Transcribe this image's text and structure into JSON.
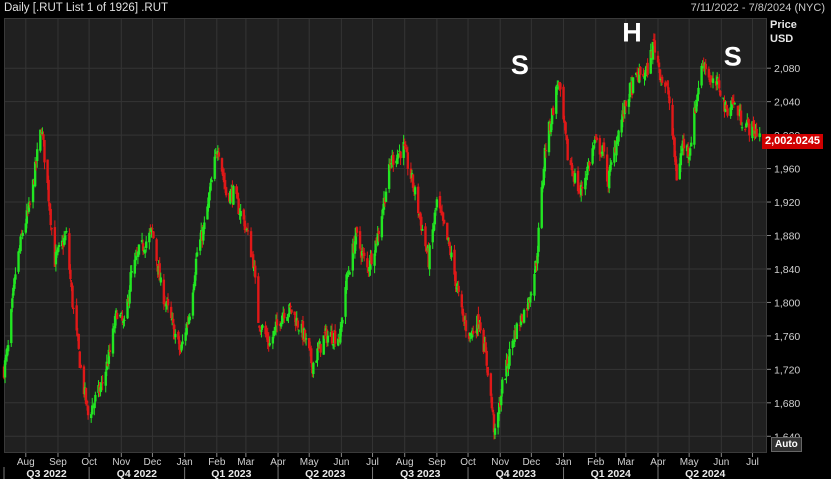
{
  "header": {
    "title": "Daily [.RUT List 1 of 1926] .RUT",
    "date_range": "7/11/2022 - 7/8/2024 (NYC)"
  },
  "axis": {
    "price_label": "Price",
    "currency": "USD",
    "auto_label": "Auto",
    "last_value": "2,002.0245"
  },
  "annotations": [
    {
      "text": "S",
      "date": "2023-11-20",
      "price": 2073
    },
    {
      "text": "H",
      "date": "2024-03-07",
      "price": 2112
    },
    {
      "text": "S",
      "date": "2024-06-12",
      "price": 2083
    }
  ],
  "colors": {
    "up": "#22e622",
    "down": "#e01818",
    "background": "#202020",
    "grid": "#343434",
    "last_price_bg": "#d00000"
  },
  "chart_data": {
    "type": "candlestick",
    "title": "Daily [.RUT List 1 of 1926] .RUT",
    "ylabel": "Price USD",
    "ylim": [
      1620,
      2140
    ],
    "xlim": [
      "2022-07-11",
      "2024-07-15"
    ],
    "y_ticks": [
      "1,640",
      "1,680",
      "1,720",
      "1,760",
      "1,800",
      "1,840",
      "1,880",
      "1,920",
      "1,960",
      "2,000",
      "2,040",
      "2,080"
    ],
    "month_ticks": [
      {
        "label": "Aug",
        "date": "2022-08-01"
      },
      {
        "label": "Sep",
        "date": "2022-09-01"
      },
      {
        "label": "Oct",
        "date": "2022-10-01"
      },
      {
        "label": "Nov",
        "date": "2022-11-01"
      },
      {
        "label": "Dec",
        "date": "2022-12-01"
      },
      {
        "label": "Jan",
        "date": "2023-01-01"
      },
      {
        "label": "Feb",
        "date": "2023-02-01"
      },
      {
        "label": "Mar",
        "date": "2023-03-01"
      },
      {
        "label": "Apr",
        "date": "2023-04-01"
      },
      {
        "label": "May",
        "date": "2023-05-01"
      },
      {
        "label": "Jun",
        "date": "2023-06-01"
      },
      {
        "label": "Jul",
        "date": "2023-07-01"
      },
      {
        "label": "Aug",
        "date": "2023-08-01"
      },
      {
        "label": "Sep",
        "date": "2023-09-01"
      },
      {
        "label": "Oct",
        "date": "2023-10-01"
      },
      {
        "label": "Nov",
        "date": "2023-11-01"
      },
      {
        "label": "Dec",
        "date": "2023-12-01"
      },
      {
        "label": "Jan",
        "date": "2024-01-01"
      },
      {
        "label": "Feb",
        "date": "2024-02-01"
      },
      {
        "label": "Mar",
        "date": "2024-03-01"
      },
      {
        "label": "Apr",
        "date": "2024-04-01"
      },
      {
        "label": "May",
        "date": "2024-05-01"
      },
      {
        "label": "Jun",
        "date": "2024-06-01"
      },
      {
        "label": "Jul",
        "date": "2024-07-01"
      }
    ],
    "quarter_ticks": [
      {
        "label": "Q3 2022",
        "start": "2022-07-11",
        "end": "2022-10-01"
      },
      {
        "label": "Q4 2022",
        "start": "2022-10-01",
        "end": "2023-01-01"
      },
      {
        "label": "Q1 2023",
        "start": "2023-01-01",
        "end": "2023-04-01"
      },
      {
        "label": "Q2 2023",
        "start": "2023-04-01",
        "end": "2023-07-01"
      },
      {
        "label": "Q3 2023",
        "start": "2023-07-01",
        "end": "2023-10-01"
      },
      {
        "label": "Q4 2023",
        "start": "2023-10-01",
        "end": "2024-01-01"
      },
      {
        "label": "Q1 2024",
        "start": "2024-01-01",
        "end": "2024-04-01"
      },
      {
        "label": "Q2 2024",
        "start": "2024-04-01",
        "end": "2024-07-01"
      }
    ],
    "close_path": [
      {
        "date": "2022-07-11",
        "close": 1720
      },
      {
        "date": "2022-07-15",
        "close": 1745
      },
      {
        "date": "2022-07-22",
        "close": 1835
      },
      {
        "date": "2022-07-29",
        "close": 1885
      },
      {
        "date": "2022-08-05",
        "close": 1915
      },
      {
        "date": "2022-08-16",
        "close": 2010
      },
      {
        "date": "2022-08-22",
        "close": 1940
      },
      {
        "date": "2022-08-29",
        "close": 1850
      },
      {
        "date": "2022-09-09",
        "close": 1880
      },
      {
        "date": "2022-09-15",
        "close": 1800
      },
      {
        "date": "2022-09-23",
        "close": 1720
      },
      {
        "date": "2022-09-30",
        "close": 1665
      },
      {
        "date": "2022-10-13",
        "close": 1700
      },
      {
        "date": "2022-10-21",
        "close": 1740
      },
      {
        "date": "2022-10-28",
        "close": 1790
      },
      {
        "date": "2022-11-04",
        "close": 1770
      },
      {
        "date": "2022-11-10",
        "close": 1830
      },
      {
        "date": "2022-11-18",
        "close": 1860
      },
      {
        "date": "2022-12-01",
        "close": 1885
      },
      {
        "date": "2022-12-09",
        "close": 1820
      },
      {
        "date": "2022-12-16",
        "close": 1790
      },
      {
        "date": "2022-12-28",
        "close": 1740
      },
      {
        "date": "2023-01-06",
        "close": 1790
      },
      {
        "date": "2023-01-13",
        "close": 1860
      },
      {
        "date": "2023-01-20",
        "close": 1890
      },
      {
        "date": "2023-02-02",
        "close": 1990
      },
      {
        "date": "2023-02-10",
        "close": 1930
      },
      {
        "date": "2023-02-17",
        "close": 1930
      },
      {
        "date": "2023-03-01",
        "close": 1890
      },
      {
        "date": "2023-03-08",
        "close": 1850
      },
      {
        "date": "2023-03-13",
        "close": 1780
      },
      {
        "date": "2023-03-24",
        "close": 1750
      },
      {
        "date": "2023-04-06",
        "close": 1790
      },
      {
        "date": "2023-04-14",
        "close": 1790
      },
      {
        "date": "2023-04-26",
        "close": 1760
      },
      {
        "date": "2023-05-04",
        "close": 1725
      },
      {
        "date": "2023-05-16",
        "close": 1760
      },
      {
        "date": "2023-05-31",
        "close": 1760
      },
      {
        "date": "2023-06-05",
        "close": 1820
      },
      {
        "date": "2023-06-15",
        "close": 1880
      },
      {
        "date": "2023-06-26",
        "close": 1840
      },
      {
        "date": "2023-07-06",
        "close": 1880
      },
      {
        "date": "2023-07-19",
        "close": 1970
      },
      {
        "date": "2023-07-31",
        "close": 1985
      },
      {
        "date": "2023-08-11",
        "close": 1930
      },
      {
        "date": "2023-08-24",
        "close": 1850
      },
      {
        "date": "2023-09-01",
        "close": 1920
      },
      {
        "date": "2023-09-14",
        "close": 1860
      },
      {
        "date": "2023-09-26",
        "close": 1780
      },
      {
        "date": "2023-10-03",
        "close": 1760
      },
      {
        "date": "2023-10-12",
        "close": 1780
      },
      {
        "date": "2023-10-20",
        "close": 1720
      },
      {
        "date": "2023-10-27",
        "close": 1640
      },
      {
        "date": "2023-11-03",
        "close": 1700
      },
      {
        "date": "2023-11-14",
        "close": 1760
      },
      {
        "date": "2023-11-28",
        "close": 1800
      },
      {
        "date": "2023-12-06",
        "close": 1850
      },
      {
        "date": "2023-12-14",
        "close": 1980
      },
      {
        "date": "2023-12-27",
        "close": 2065
      },
      {
        "date": "2024-01-05",
        "close": 1975
      },
      {
        "date": "2024-01-17",
        "close": 1930
      },
      {
        "date": "2024-01-31",
        "close": 1990
      },
      {
        "date": "2024-02-08",
        "close": 1980
      },
      {
        "date": "2024-02-13",
        "close": 1945
      },
      {
        "date": "2024-02-22",
        "close": 2000
      },
      {
        "date": "2024-03-04",
        "close": 2050
      },
      {
        "date": "2024-03-12",
        "close": 2070
      },
      {
        "date": "2024-03-21",
        "close": 2075
      },
      {
        "date": "2024-03-28",
        "close": 2110
      },
      {
        "date": "2024-04-04",
        "close": 2070
      },
      {
        "date": "2024-04-11",
        "close": 2050
      },
      {
        "date": "2024-04-19",
        "close": 1950
      },
      {
        "date": "2024-04-25",
        "close": 1990
      },
      {
        "date": "2024-05-01",
        "close": 1980
      },
      {
        "date": "2024-05-10",
        "close": 2060
      },
      {
        "date": "2024-05-15",
        "close": 2090
      },
      {
        "date": "2024-05-23",
        "close": 2060
      },
      {
        "date": "2024-05-30",
        "close": 2060
      },
      {
        "date": "2024-06-05",
        "close": 2030
      },
      {
        "date": "2024-06-12",
        "close": 2040
      },
      {
        "date": "2024-06-20",
        "close": 2020
      },
      {
        "date": "2024-06-27",
        "close": 2010
      },
      {
        "date": "2024-07-08",
        "close": 2002.0245
      }
    ],
    "last_close": 2002.0245
  }
}
